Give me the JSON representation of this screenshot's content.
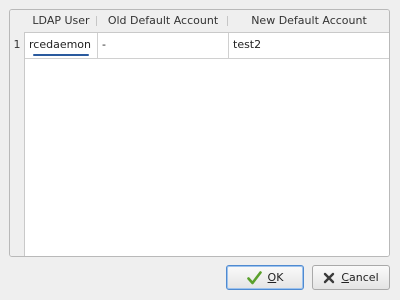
{
  "table": {
    "columns": [
      "LDAP User",
      "Old Default Account",
      "New Default Account"
    ],
    "rows": [
      {
        "number": "1",
        "ldap_user": "rcedaemon",
        "old_default_account": "-",
        "new_default_account": "test2"
      }
    ]
  },
  "buttons": {
    "ok": {
      "mnemonic": "O",
      "rest": "K",
      "icon": "checkmark-icon",
      "color": "#5aa02c"
    },
    "cancel": {
      "mnemonic": "C",
      "rest": "ancel",
      "icon": "x-icon",
      "color": "#3a3a3a"
    }
  }
}
